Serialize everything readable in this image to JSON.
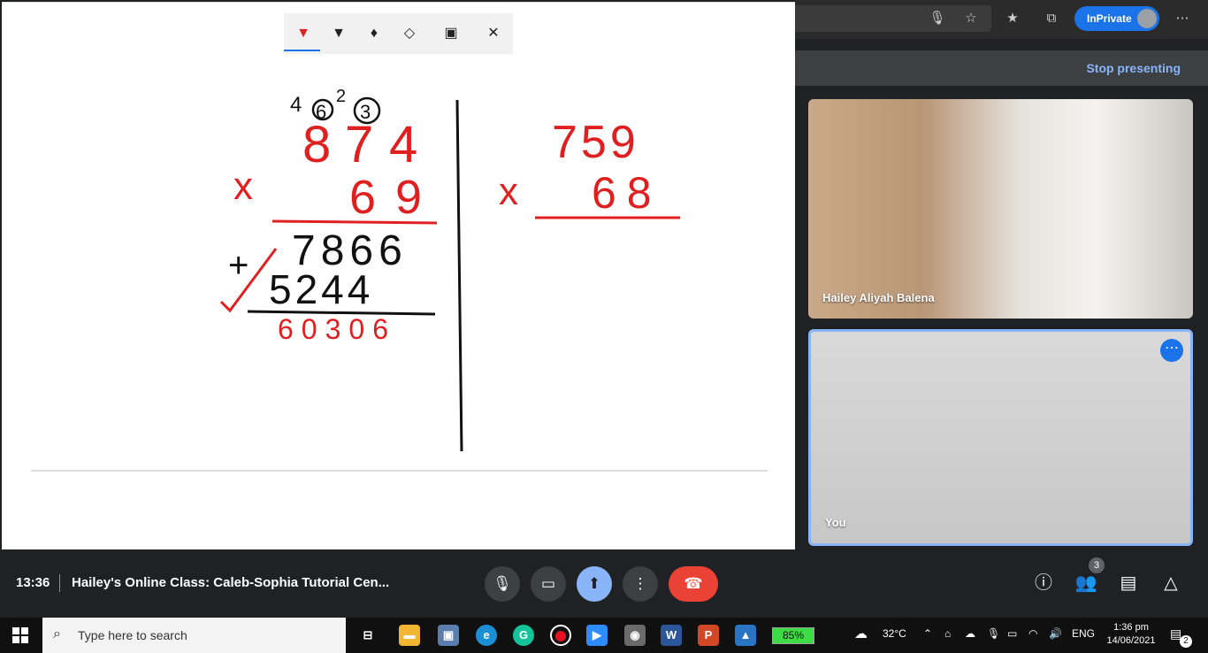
{
  "browser": {
    "inprivate_label": "InPrivate"
  },
  "meet": {
    "stop_presenting": "Stop presenting",
    "time": "13:36",
    "meeting_title": "Hailey's Online Class: Caleb-Sophia Tutorial Cen...",
    "participants_count": "3",
    "tiles": [
      {
        "name": "Hailey Aliyah Balena"
      },
      {
        "name": "You"
      }
    ]
  },
  "whiteboard": {
    "problem1": {
      "carries": [
        "4",
        "6",
        "2",
        "3"
      ],
      "top_digits": [
        "8",
        "7",
        "4"
      ],
      "multiplier_digits": [
        "6",
        "9"
      ],
      "times_sign": "x",
      "partial1": "7866",
      "plus_sign": "+",
      "partial2": "5244",
      "result": "60306"
    },
    "problem2": {
      "top": "759",
      "times_sign": "x",
      "multiplier": "68"
    }
  },
  "taskbar": {
    "search_placeholder": "Type here to search",
    "battery": "85%",
    "temperature": "32°C",
    "language": "ENG",
    "time": "1:36 pm",
    "date": "14/06/2021",
    "notification_count": "2"
  },
  "colors": {
    "ink_red": "#e02020",
    "ink_black": "#111111",
    "accent_blue": "#1a73e8",
    "leave_red": "#ea4335"
  }
}
